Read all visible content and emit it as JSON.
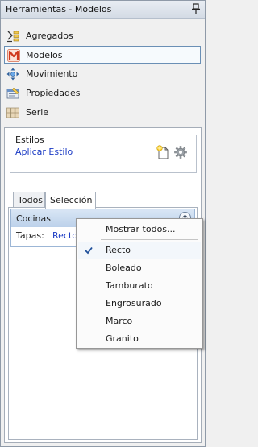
{
  "window": {
    "title": "Herramientas - Modelos",
    "pin_icon": "pin-icon"
  },
  "nav": {
    "items": [
      {
        "label": "Agregados",
        "icon": "aggregate-icon",
        "selected": false
      },
      {
        "label": "Modelos",
        "icon": "models-icon",
        "selected": true
      },
      {
        "label": "Movimiento",
        "icon": "move-icon",
        "selected": false
      },
      {
        "label": "Propiedades",
        "icon": "properties-icon",
        "selected": false
      },
      {
        "label": "Serie",
        "icon": "series-icon",
        "selected": false
      }
    ]
  },
  "styles_group": {
    "title": "Estilos",
    "apply_link": "Aplicar Estilo",
    "new_icon": "new-style-icon",
    "settings_icon": "gear-icon"
  },
  "tabs": [
    {
      "label": "Todos",
      "active": false
    },
    {
      "label": "Selección",
      "active": true
    }
  ],
  "section": {
    "title": "Cocinas",
    "collapse_icon": "chevron-double-up-icon",
    "field_label": "Tapas:",
    "field_value": "Recto"
  },
  "context_menu": {
    "show_all": "Mostrar todos...",
    "items": [
      {
        "label": "Recto",
        "checked": true
      },
      {
        "label": "Boleado",
        "checked": false
      },
      {
        "label": "Tamburato",
        "checked": false
      },
      {
        "label": "Engrosurado",
        "checked": false
      },
      {
        "label": "Marco",
        "checked": false
      },
      {
        "label": "Granito",
        "checked": false
      }
    ]
  },
  "colors": {
    "accent_link": "#1a3ac4",
    "selection_border": "#6a8fb5",
    "section_header": "#bcd1ea"
  }
}
